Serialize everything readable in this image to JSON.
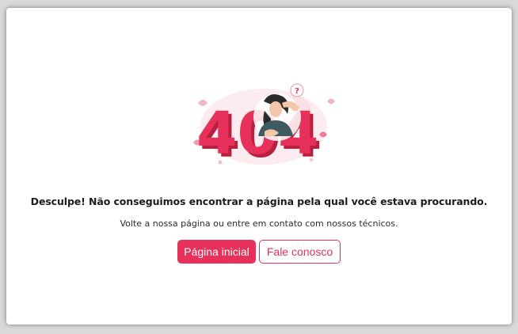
{
  "error": {
    "code_text": "404",
    "question_mark": "?",
    "illustration_icon": "confused-person-404-illustration",
    "headline": "Desculpe! Não conseguimos encontrar a página pela qual você estava procurando.",
    "subline": "Volte a nossa página ou entre em contato com nossos técnicos."
  },
  "actions": {
    "home_label": "Página inicial",
    "contact_label": "Fale conosco"
  },
  "colors": {
    "accent": "#e8315a",
    "accent_dark": "#b8203f",
    "card_bg": "#ffffff",
    "page_bg": "#d9d9d9"
  }
}
